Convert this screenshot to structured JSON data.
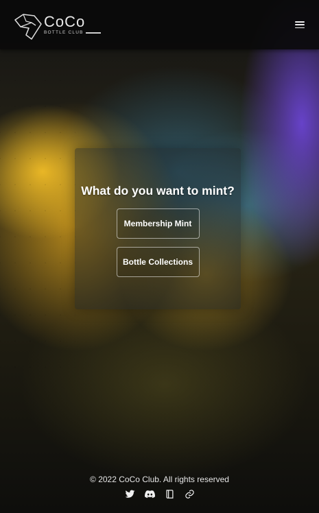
{
  "header": {
    "logo_title": "CoCo",
    "logo_subtitle": "BOTTLE CLUB",
    "menu_icon": "hamburger-menu-icon"
  },
  "main": {
    "question": "What do you want to mint?",
    "buttons": [
      {
        "label": "Membership Mint"
      },
      {
        "label": "Bottle Collections"
      }
    ]
  },
  "footer": {
    "copyright": "© 2022 CoCo Club. All rights reserved",
    "socials": [
      {
        "icon": "twitter-icon"
      },
      {
        "icon": "discord-icon"
      },
      {
        "icon": "book-icon"
      },
      {
        "icon": "link-icon"
      }
    ]
  },
  "colors": {
    "header_bg": "#0a0a0a",
    "text": "#ffffff",
    "accent_gold": "#e6aa1e",
    "accent_purple": "#6e46dc"
  }
}
